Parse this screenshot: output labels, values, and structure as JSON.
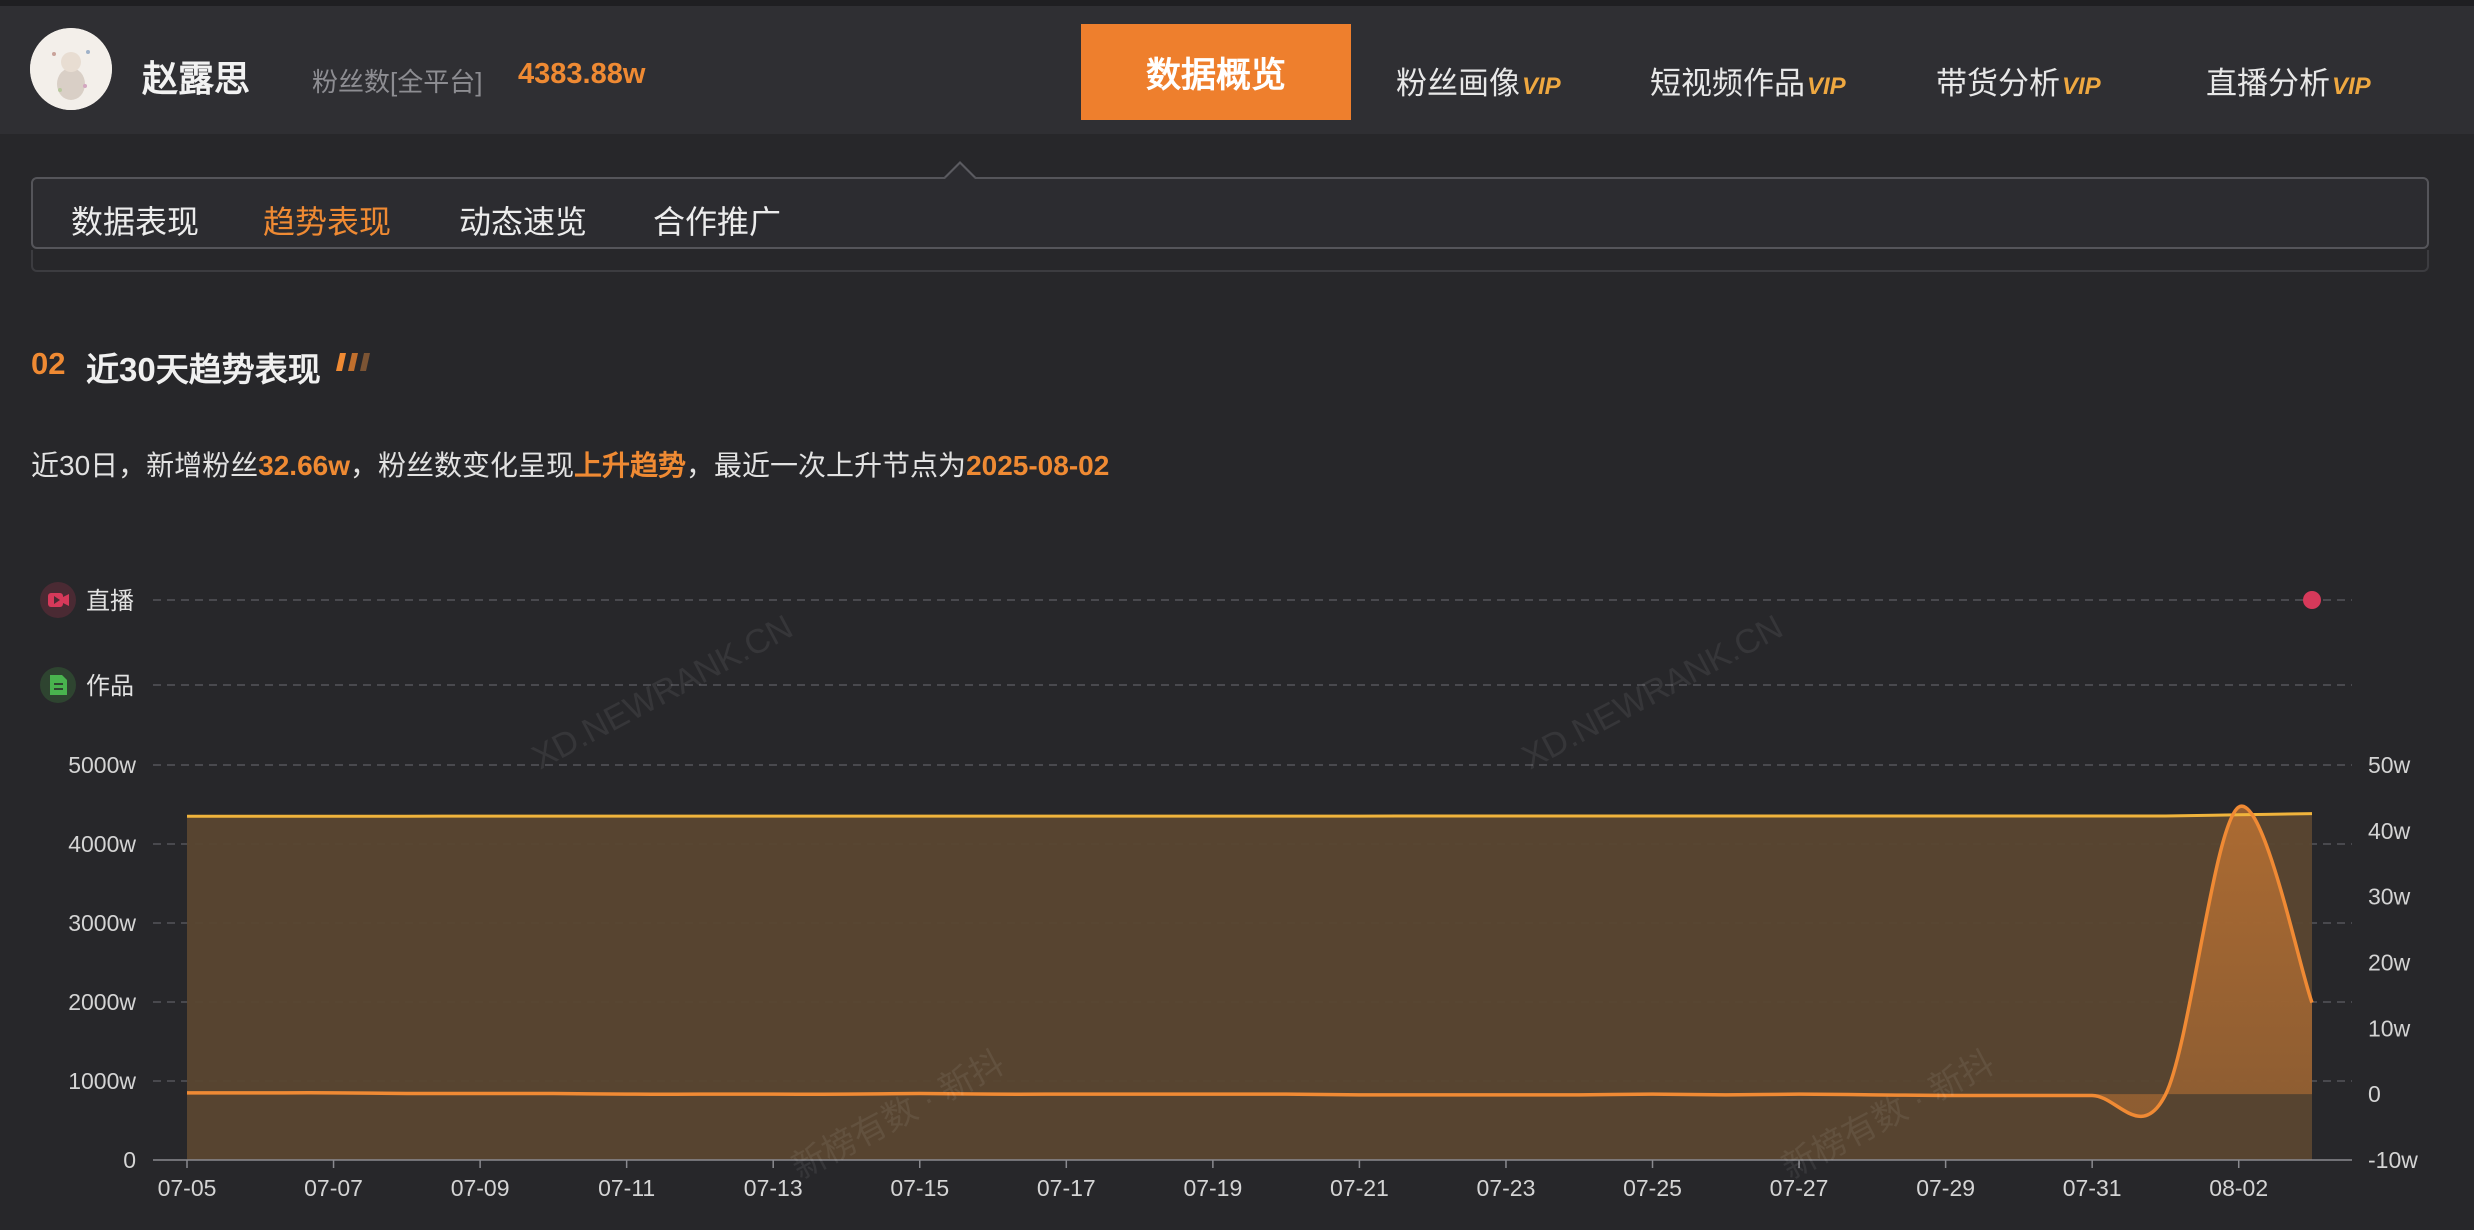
{
  "header": {
    "user_name": "赵露思",
    "fans_label": "粉丝数[全平台]",
    "fans_value": "4383.88w",
    "nav": {
      "active": "数据概览",
      "items": [
        {
          "label": "粉丝画像",
          "vip": "VIP"
        },
        {
          "label": "短视频作品",
          "vip": "VIP"
        },
        {
          "label": "带货分析",
          "vip": "VIP"
        },
        {
          "label": "直播分析",
          "vip": "VIP"
        }
      ]
    }
  },
  "subtabs": [
    "数据表现",
    "趋势表现",
    "动态速览",
    "合作推广"
  ],
  "subtab_active_index": 1,
  "section": {
    "number": "02",
    "title": "近30天趋势表现"
  },
  "summary": {
    "p1": "近30日，新增粉丝",
    "v1": "32.66w",
    "p2": "，粉丝数变化呈现",
    "v2": "上升趋势",
    "p3": "，最近一次上升节点为",
    "v3": "2025-08-02"
  },
  "watermarks": [
    "XD.NEWRANK.CN",
    "新榜有数 · 新抖"
  ],
  "chart_data": {
    "type": "area",
    "events": [
      {
        "name": "直播",
        "color": "#d6395a",
        "icon": "live-icon",
        "dates": [
          "08-03"
        ]
      },
      {
        "name": "作品",
        "color": "#49b34e",
        "icon": "document-icon",
        "dates": []
      }
    ],
    "x": [
      "07-05",
      "07-06",
      "07-07",
      "07-08",
      "07-09",
      "07-10",
      "07-11",
      "07-12",
      "07-13",
      "07-14",
      "07-15",
      "07-16",
      "07-17",
      "07-18",
      "07-19",
      "07-20",
      "07-21",
      "07-22",
      "07-23",
      "07-24",
      "07-25",
      "07-26",
      "07-27",
      "07-28",
      "07-29",
      "07-30",
      "07-31",
      "08-01",
      "08-02",
      "08-03"
    ],
    "x_tick_labels": [
      "07-05",
      "07-07",
      "07-09",
      "07-11",
      "07-13",
      "07-15",
      "07-17",
      "07-19",
      "07-21",
      "07-23",
      "07-25",
      "07-27",
      "07-29",
      "07-31",
      "08-02"
    ],
    "y_left": {
      "ticks": [
        "0",
        "1000w",
        "2000w",
        "3000w",
        "4000w",
        "5000w"
      ],
      "lim": [
        0,
        5000
      ]
    },
    "y_right": {
      "ticks": [
        "-10w",
        "0",
        "10w",
        "20w",
        "30w",
        "40w",
        "50w"
      ],
      "lim": [
        -10,
        50
      ]
    },
    "series": [
      {
        "axis": "left",
        "color": "#f0b43c",
        "values": [
          4351.2,
          4351.5,
          4351.8,
          4352.0,
          4352.2,
          4352.4,
          4352.5,
          4352.7,
          4352.8,
          4352.9,
          4353.0,
          4353.1,
          4353.2,
          4353.3,
          4353.4,
          4353.5,
          4353.6,
          4353.7,
          4353.8,
          4353.9,
          4354.0,
          4354.1,
          4354.2,
          4354.3,
          4354.4,
          4354.5,
          4354.6,
          4355.0,
          4370.0,
          4383.88
        ]
      },
      {
        "axis": "right",
        "color": "#f08a34",
        "values": [
          0.2,
          0.2,
          0.2,
          0.1,
          0.1,
          0.1,
          0.0,
          0.0,
          0.0,
          0.0,
          0.1,
          0.0,
          0.0,
          0.0,
          0.0,
          0.0,
          -0.1,
          -0.1,
          -0.1,
          -0.1,
          0.0,
          -0.1,
          0.0,
          -0.1,
          -0.2,
          -0.2,
          -0.2,
          -0.1,
          43.6,
          13.9
        ]
      }
    ]
  }
}
